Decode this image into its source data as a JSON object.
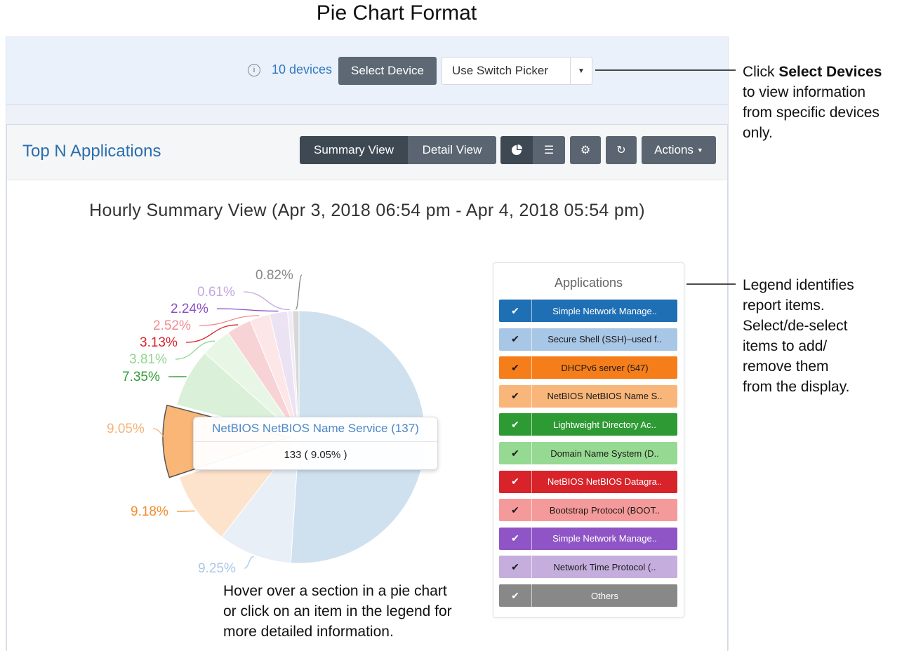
{
  "doc_title": "Pie Chart Format",
  "toolbar": {
    "info_icon": "info-circle-icon",
    "devices_link": "10 devices",
    "select_device_label": "Select Device",
    "switch_picker_label": "Use Switch Picker",
    "dropdown_icon": "caret-down-icon"
  },
  "panel": {
    "title": "Top N Applications",
    "summary_view_label": "Summary View",
    "detail_view_label": "Detail View",
    "pie_icon": "pie-chart-icon",
    "table_icon": "table-icon",
    "settings_icon": "gear-icon",
    "refresh_icon": "refresh-icon",
    "actions_label": "Actions"
  },
  "chart_data": {
    "type": "pie",
    "title": "Hourly Summary View (Apr 3, 2018 06:54 pm - Apr 4, 2018 05:54 pm)",
    "slices": [
      {
        "name": "Simple Network Manage..",
        "value": 50.0,
        "label": "",
        "color": "#cfe0ee"
      },
      {
        "name": "Secure Shell (SSH)–used f..",
        "value": 9.25,
        "label": "9.25%",
        "color": "#e9eff7"
      },
      {
        "name": "DHCPv6 server (547)",
        "value": 9.18,
        "label": "9.18%",
        "color": "#fde2cc"
      },
      {
        "name": "NetBIOS NetBIOS Name S..",
        "value": 9.05,
        "label": "9.05%",
        "color": "#f9b677"
      },
      {
        "name": "Lightweight Directory Ac..",
        "value": 7.35,
        "label": "7.35%",
        "color": "#daf0d8"
      },
      {
        "name": "Domain Name System (D..",
        "value": 3.81,
        "label": "3.81%",
        "color": "#e8f6e6"
      },
      {
        "name": "NetBIOS NetBIOS Datagra..",
        "value": 3.13,
        "label": "3.13%",
        "color": "#f8d3d6"
      },
      {
        "name": "Bootstrap Protocol (BOOT..",
        "value": 2.52,
        "label": "2.52%",
        "color": "#fde6e8"
      },
      {
        "name": "Simple Network Manage..",
        "value": 2.24,
        "label": "2.24%",
        "color": "#ebe3f3"
      },
      {
        "name": "Network Time Protocol (..",
        "value": 0.61,
        "label": "0.61%",
        "color": "#f1ecf6"
      },
      {
        "name": "Others",
        "value": 0.82,
        "label": "0.82%",
        "color": "#d8d8d8"
      }
    ],
    "label_colors": [
      "",
      "#a9c7e8",
      "#f58b2f",
      "#f7b27a",
      "#2e9b32",
      "#8fd68c",
      "#d9232b",
      "#f28c8f",
      "#8a4fc5",
      "#c4a7e0",
      "#888888"
    ],
    "tooltip": {
      "title": "NetBIOS NetBIOS Name Service (137)",
      "value": "133 ( 9.05% )"
    }
  },
  "legend": {
    "title": "Applications",
    "items": [
      {
        "label": "Simple Network Manage..",
        "bg": "#1f6fb5",
        "fg": "#ffffff"
      },
      {
        "label": "Secure Shell (SSH)–used f..",
        "bg": "#a8c6e6",
        "fg": "#1a1a1a"
      },
      {
        "label": "DHCPv6 server (547)",
        "bg": "#f57e1a",
        "fg": "#1a1a1a"
      },
      {
        "label": "NetBIOS NetBIOS Name S..",
        "bg": "#f9b67a",
        "fg": "#1a1a1a"
      },
      {
        "label": "Lightweight Directory Ac..",
        "bg": "#2e9a34",
        "fg": "#ffffff"
      },
      {
        "label": "Domain Name System (D..",
        "bg": "#96d992",
        "fg": "#1a1a1a"
      },
      {
        "label": "NetBIOS NetBIOS Datagra..",
        "bg": "#d8232a",
        "fg": "#ffffff"
      },
      {
        "label": "Bootstrap Protocol (BOOT..",
        "bg": "#f59a9a",
        "fg": "#1a1a1a"
      },
      {
        "label": "Simple Network Manage..",
        "bg": "#8f55c6",
        "fg": "#ffffff"
      },
      {
        "label": "Network Time Protocol (..",
        "bg": "#c5aedd",
        "fg": "#1a1a1a"
      },
      {
        "label": "Others",
        "bg": "#888888",
        "fg": "#ffffff"
      }
    ]
  },
  "annotations": {
    "select_prefix": "Click ",
    "select_bold": "Select Devices",
    "select_rest": [
      "to view information",
      "from specific devices",
      "only."
    ],
    "legend_lines": [
      "Legend identifies",
      "report items.",
      "Select/de-select",
      "items to add/",
      "remove them",
      "from the display."
    ],
    "hover_lines": [
      "Hover over a section in a pie chart",
      "or click on an item in the legend for",
      "more detailed information."
    ]
  }
}
